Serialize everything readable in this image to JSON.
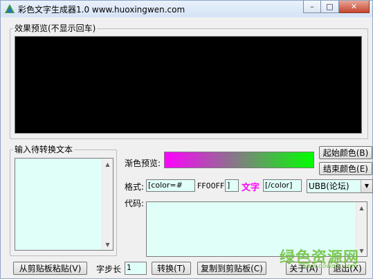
{
  "window": {
    "title": "彩色文字生成器1.0  www.huoxingwen.com",
    "minimize_symbol": "–",
    "maximize_symbol": "□",
    "close_symbol": "✕"
  },
  "preview": {
    "legend": "效果预览(不显示回车)"
  },
  "input": {
    "legend": "输入待转换文本",
    "value": ""
  },
  "gradient": {
    "label": "渐色预览:",
    "start_color": "#ff00ff",
    "end_color": "#00ff00",
    "start_button": "起始颜色(B)",
    "end_button": "结束颜色(E)"
  },
  "format": {
    "label": "格式:",
    "prefix": "[color=#",
    "color_code": "FF00FF",
    "bracket": "]",
    "sample": "文字",
    "suffix": "[/color]",
    "mode_selected": "UBB(论坛)"
  },
  "code": {
    "label": "代码:",
    "value": ""
  },
  "bottom": {
    "paste_button": "从剪贴板粘贴(V)",
    "step_label": "字步长",
    "step_value": "1",
    "convert_button": "转换(T)",
    "copy_button": "复制到剪贴板(C)",
    "about_button": "关于(A)",
    "exit_button": "退出(X)"
  },
  "watermark": {
    "text": "绿色资源网",
    "url": "www.downcc.com"
  },
  "icons": {
    "app": "app-icon",
    "scroll_up": "▲",
    "scroll_down": "▼",
    "dropdown": "▼"
  }
}
